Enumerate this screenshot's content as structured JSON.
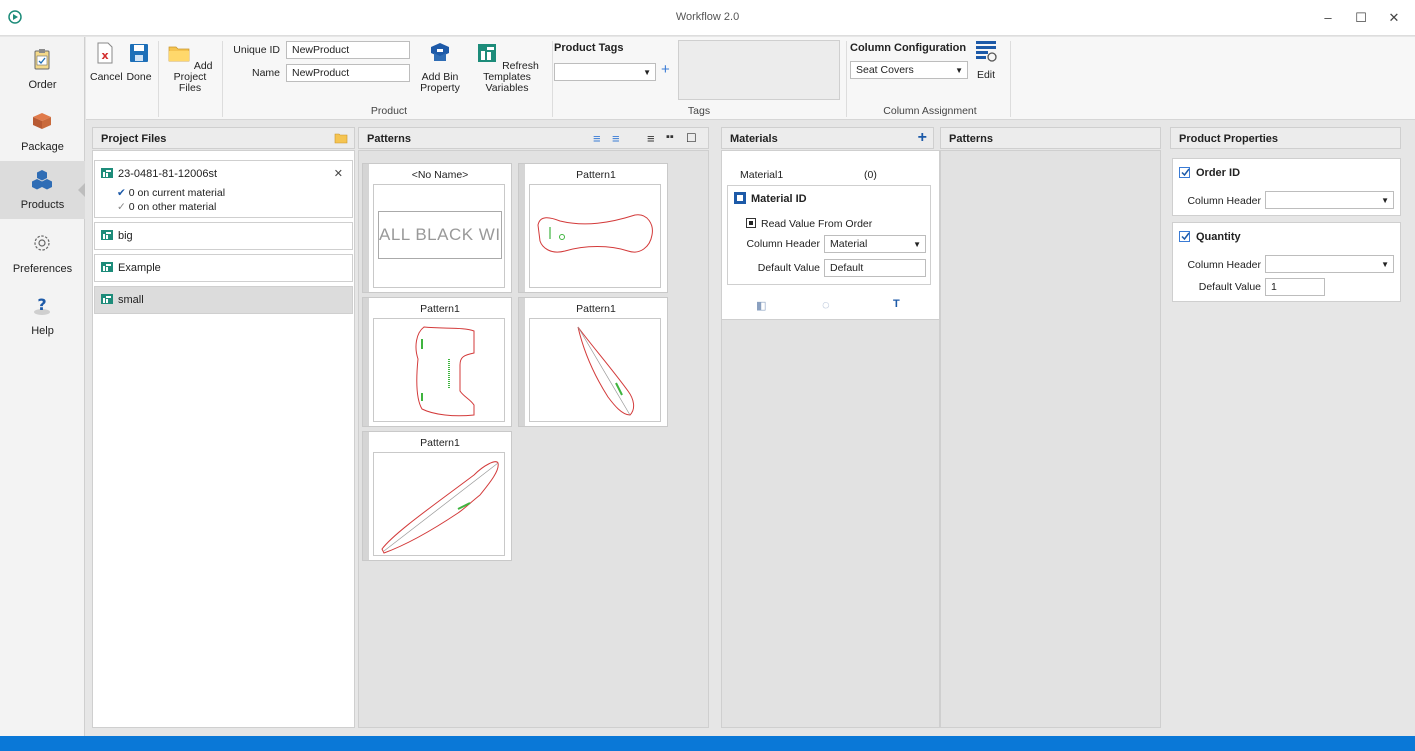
{
  "window": {
    "title": "Workflow 2.0",
    "minimize": "–",
    "maximize": "☐",
    "close": "✕"
  },
  "nav": [
    {
      "label": "Order",
      "icon": "clipboard-icon"
    },
    {
      "label": "Package",
      "icon": "box-icon"
    },
    {
      "label": "Products",
      "icon": "cubes-icon",
      "active": true
    },
    {
      "label": "Preferences",
      "icon": "gear-icon"
    },
    {
      "label": "Help",
      "icon": "help-icon"
    }
  ],
  "ribbon": {
    "cancel": "Cancel",
    "done": "Done",
    "add_project_files": "Add Project Files",
    "unique_id_label": "Unique ID",
    "unique_id_value": "NewProduct",
    "name_label": "Name",
    "name_value": "NewProduct",
    "add_bin_property": "Add Bin Property",
    "refresh_templates": "Refresh Templates Variables",
    "product_group": "Product",
    "product_tags_title": "Product Tags",
    "tags_group": "Tags",
    "plus": "+",
    "column_configuration_title": "Column Configuration",
    "column_configuration_value": "Seat Covers",
    "edit": "Edit",
    "column_assignment_group": "Column Assignment"
  },
  "project_files": {
    "header": "Project Files",
    "file": {
      "name": "23-0481-81-12006st",
      "close": "✕",
      "current": "0 on current material",
      "other": "0 on other material"
    },
    "items": [
      "big",
      "Example",
      "small"
    ]
  },
  "patterns": {
    "header": "Patterns",
    "cards": [
      "<No Name>",
      "Pattern1",
      "Pattern1",
      "Pattern1",
      "Pattern1"
    ],
    "no_name_text": "ALL BLACK WIRE"
  },
  "materials": {
    "header": "Materials",
    "add": "+",
    "material_name": "Material1",
    "material_count": "(0)",
    "material_id_title": "Material ID",
    "read_value": "Read Value From Order",
    "column_header_label": "Column Header",
    "column_header_value": "Material",
    "default_value_label": "Default Value",
    "default_value": "Default",
    "text_tool": "T"
  },
  "patterns2": {
    "header": "Patterns"
  },
  "product_properties": {
    "header": "Product Properties",
    "order_id": {
      "title": "Order ID",
      "column_header_label": "Column Header",
      "column_header_value": ""
    },
    "quantity": {
      "title": "Quantity",
      "column_header_label": "Column Header",
      "column_header_value": "",
      "default_value_label": "Default Value",
      "default_value": "1"
    }
  },
  "colors": {
    "accent": "#0a78d7",
    "teal": "#1d8c7a",
    "pattern_outline": "#d33a3a",
    "pattern_mark": "#3fb43f"
  }
}
